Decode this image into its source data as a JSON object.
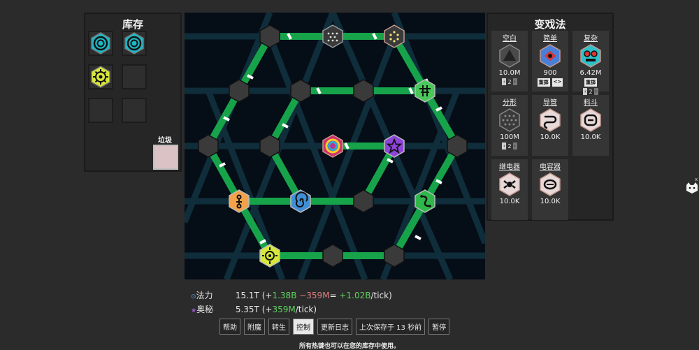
{
  "inventory": {
    "title": "库存",
    "trash_label": "垃圾",
    "slots": [
      {
        "icon": "vortex-rune-icon"
      },
      {
        "icon": "vortex-rune-icon"
      },
      {
        "icon": "sun-rune-icon"
      },
      {
        "icon": ""
      },
      {
        "icon": ""
      },
      {
        "icon": ""
      }
    ]
  },
  "spells": {
    "title": "变戏法",
    "cards": [
      {
        "name": "空白",
        "count": "10.0M",
        "step": "2"
      },
      {
        "name": "简单",
        "count": "900",
        "btn1": "重掷",
        "btn2": "<>"
      },
      {
        "name": "复杂",
        "count": "6.42M",
        "btn1": "重掷",
        "step": "2"
      },
      {
        "name": "分形",
        "count": "100M",
        "step": "2"
      },
      {
        "name": "导管",
        "count": "10.0K"
      },
      {
        "name": "料斗",
        "count": "10.0K"
      },
      {
        "name": "继电器",
        "count": "10.0K"
      },
      {
        "name": "电容器",
        "count": "10.0K"
      }
    ]
  },
  "stats": {
    "mana_label": "法力",
    "mana_value": "15.1T",
    "mana_open": "(+",
    "mana_gain": "1.38B",
    "mana_loss": " −359M",
    "mana_eq": "=",
    "mana_net": " +1.02B",
    "mana_rate": "/tick)",
    "arcane_label": "奥秘",
    "arcane_value": "5.35T",
    "arcane_open": "(+",
    "arcane_gain": "359M",
    "arcane_rate": "/tick)"
  },
  "toolbar": {
    "help": "帮助",
    "enchant": "附魔",
    "rebirth": "转生",
    "control": "控制",
    "changelog": "更新日志",
    "save": "上次保存于 13 秒前",
    "pause": "暂停"
  },
  "hint": "所有热键也可以在您的库存中使用。",
  "colors": {
    "green": "#17a34a",
    "board": "#050d17",
    "hex": "#3a3a3a"
  }
}
